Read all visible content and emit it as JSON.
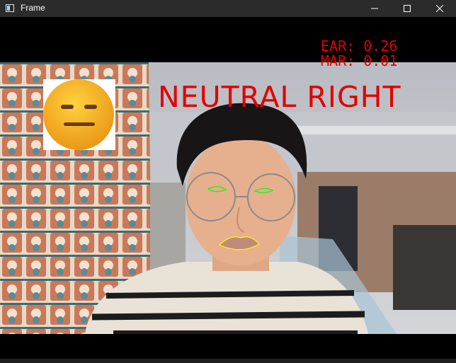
{
  "window": {
    "title": "Frame",
    "controls": [
      "minimize",
      "maximize",
      "close"
    ]
  },
  "overlay": {
    "ear": "EAR: 0.26",
    "mar": "MAR: 0.01",
    "expression_label": "NEUTRAL RIGHT",
    "emoji": "neutral-face-emoji"
  },
  "colors": {
    "overlay_text": "#e10000",
    "eye_contour": "#00ff00",
    "mouth_contour": "#ffff00",
    "titlebar": "#2b2b2b"
  }
}
